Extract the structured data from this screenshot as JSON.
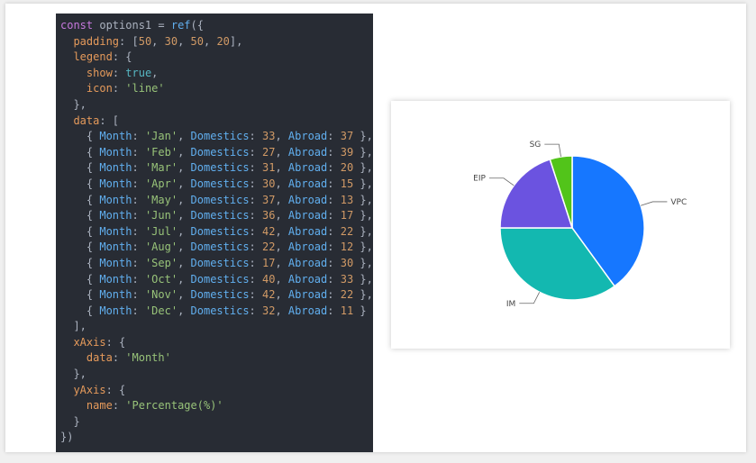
{
  "code": {
    "lines": [
      [
        [
          "const ",
          "kw"
        ],
        [
          "options1 = ",
          "punc"
        ],
        [
          "ref",
          "fn"
        ],
        [
          "({",
          "punc"
        ]
      ],
      [
        [
          "  ",
          "punc"
        ],
        [
          "padding",
          "prop"
        ],
        [
          ": [",
          "punc"
        ],
        [
          "50",
          "num"
        ],
        [
          ", ",
          "punc"
        ],
        [
          "30",
          "num"
        ],
        [
          ", ",
          "punc"
        ],
        [
          "50",
          "num"
        ],
        [
          ", ",
          "punc"
        ],
        [
          "20",
          "num"
        ],
        [
          "],",
          "punc"
        ]
      ],
      [
        [
          "  ",
          "punc"
        ],
        [
          "legend",
          "prop"
        ],
        [
          ": {",
          "punc"
        ]
      ],
      [
        [
          "    ",
          "punc"
        ],
        [
          "show",
          "prop"
        ],
        [
          ": ",
          "punc"
        ],
        [
          "true",
          "bool"
        ],
        [
          ",",
          "punc"
        ]
      ],
      [
        [
          "    ",
          "punc"
        ],
        [
          "icon",
          "prop"
        ],
        [
          ": ",
          "punc"
        ],
        [
          "'line'",
          "str"
        ]
      ],
      [
        [
          "  },",
          "punc"
        ]
      ],
      [
        [
          "  ",
          "punc"
        ],
        [
          "data",
          "prop"
        ],
        [
          ": [",
          "punc"
        ]
      ],
      [
        [
          "    { ",
          "punc"
        ],
        [
          "Month",
          "prop2"
        ],
        [
          ": ",
          "punc"
        ],
        [
          "'Jan'",
          "str"
        ],
        [
          ", ",
          "punc"
        ],
        [
          "Domestics",
          "prop2"
        ],
        [
          ": ",
          "punc"
        ],
        [
          "33",
          "num"
        ],
        [
          ", ",
          "punc"
        ],
        [
          "Abroad",
          "prop2"
        ],
        [
          ": ",
          "punc"
        ],
        [
          "37",
          "num"
        ],
        [
          " },",
          "punc"
        ]
      ],
      [
        [
          "    { ",
          "punc"
        ],
        [
          "Month",
          "prop2"
        ],
        [
          ": ",
          "punc"
        ],
        [
          "'Feb'",
          "str"
        ],
        [
          ", ",
          "punc"
        ],
        [
          "Domestics",
          "prop2"
        ],
        [
          ": ",
          "punc"
        ],
        [
          "27",
          "num"
        ],
        [
          ", ",
          "punc"
        ],
        [
          "Abroad",
          "prop2"
        ],
        [
          ": ",
          "punc"
        ],
        [
          "39",
          "num"
        ],
        [
          " },",
          "punc"
        ]
      ],
      [
        [
          "    { ",
          "punc"
        ],
        [
          "Month",
          "prop2"
        ],
        [
          ": ",
          "punc"
        ],
        [
          "'Mar'",
          "str"
        ],
        [
          ", ",
          "punc"
        ],
        [
          "Domestics",
          "prop2"
        ],
        [
          ": ",
          "punc"
        ],
        [
          "31",
          "num"
        ],
        [
          ", ",
          "punc"
        ],
        [
          "Abroad",
          "prop2"
        ],
        [
          ": ",
          "punc"
        ],
        [
          "20",
          "num"
        ],
        [
          " },",
          "punc"
        ]
      ],
      [
        [
          "    { ",
          "punc"
        ],
        [
          "Month",
          "prop2"
        ],
        [
          ": ",
          "punc"
        ],
        [
          "'Apr'",
          "str"
        ],
        [
          ", ",
          "punc"
        ],
        [
          "Domestics",
          "prop2"
        ],
        [
          ": ",
          "punc"
        ],
        [
          "30",
          "num"
        ],
        [
          ", ",
          "punc"
        ],
        [
          "Abroad",
          "prop2"
        ],
        [
          ": ",
          "punc"
        ],
        [
          "15",
          "num"
        ],
        [
          " },",
          "punc"
        ]
      ],
      [
        [
          "    { ",
          "punc"
        ],
        [
          "Month",
          "prop2"
        ],
        [
          ": ",
          "punc"
        ],
        [
          "'May'",
          "str"
        ],
        [
          ", ",
          "punc"
        ],
        [
          "Domestics",
          "prop2"
        ],
        [
          ": ",
          "punc"
        ],
        [
          "37",
          "num"
        ],
        [
          ", ",
          "punc"
        ],
        [
          "Abroad",
          "prop2"
        ],
        [
          ": ",
          "punc"
        ],
        [
          "13",
          "num"
        ],
        [
          " },",
          "punc"
        ]
      ],
      [
        [
          "    { ",
          "punc"
        ],
        [
          "Month",
          "prop2"
        ],
        [
          ": ",
          "punc"
        ],
        [
          "'Jun'",
          "str"
        ],
        [
          ", ",
          "punc"
        ],
        [
          "Domestics",
          "prop2"
        ],
        [
          ": ",
          "punc"
        ],
        [
          "36",
          "num"
        ],
        [
          ", ",
          "punc"
        ],
        [
          "Abroad",
          "prop2"
        ],
        [
          ": ",
          "punc"
        ],
        [
          "17",
          "num"
        ],
        [
          " },",
          "punc"
        ]
      ],
      [
        [
          "    { ",
          "punc"
        ],
        [
          "Month",
          "prop2"
        ],
        [
          ": ",
          "punc"
        ],
        [
          "'Jul'",
          "str"
        ],
        [
          ", ",
          "punc"
        ],
        [
          "Domestics",
          "prop2"
        ],
        [
          ": ",
          "punc"
        ],
        [
          "42",
          "num"
        ],
        [
          ", ",
          "punc"
        ],
        [
          "Abroad",
          "prop2"
        ],
        [
          ": ",
          "punc"
        ],
        [
          "22",
          "num"
        ],
        [
          " },",
          "punc"
        ]
      ],
      [
        [
          "    { ",
          "punc"
        ],
        [
          "Month",
          "prop2"
        ],
        [
          ": ",
          "punc"
        ],
        [
          "'Aug'",
          "str"
        ],
        [
          ", ",
          "punc"
        ],
        [
          "Domestics",
          "prop2"
        ],
        [
          ": ",
          "punc"
        ],
        [
          "22",
          "num"
        ],
        [
          ", ",
          "punc"
        ],
        [
          "Abroad",
          "prop2"
        ],
        [
          ": ",
          "punc"
        ],
        [
          "12",
          "num"
        ],
        [
          " },",
          "punc"
        ]
      ],
      [
        [
          "    { ",
          "punc"
        ],
        [
          "Month",
          "prop2"
        ],
        [
          ": ",
          "punc"
        ],
        [
          "'Sep'",
          "str"
        ],
        [
          ", ",
          "punc"
        ],
        [
          "Domestics",
          "prop2"
        ],
        [
          ": ",
          "punc"
        ],
        [
          "17",
          "num"
        ],
        [
          ", ",
          "punc"
        ],
        [
          "Abroad",
          "prop2"
        ],
        [
          ": ",
          "punc"
        ],
        [
          "30",
          "num"
        ],
        [
          " },",
          "punc"
        ]
      ],
      [
        [
          "    { ",
          "punc"
        ],
        [
          "Month",
          "prop2"
        ],
        [
          ": ",
          "punc"
        ],
        [
          "'Oct'",
          "str"
        ],
        [
          ", ",
          "punc"
        ],
        [
          "Domestics",
          "prop2"
        ],
        [
          ": ",
          "punc"
        ],
        [
          "40",
          "num"
        ],
        [
          ", ",
          "punc"
        ],
        [
          "Abroad",
          "prop2"
        ],
        [
          ": ",
          "punc"
        ],
        [
          "33",
          "num"
        ],
        [
          " },",
          "punc"
        ]
      ],
      [
        [
          "    { ",
          "punc"
        ],
        [
          "Month",
          "prop2"
        ],
        [
          ": ",
          "punc"
        ],
        [
          "'Nov'",
          "str"
        ],
        [
          ", ",
          "punc"
        ],
        [
          "Domestics",
          "prop2"
        ],
        [
          ": ",
          "punc"
        ],
        [
          "42",
          "num"
        ],
        [
          ", ",
          "punc"
        ],
        [
          "Abroad",
          "prop2"
        ],
        [
          ": ",
          "punc"
        ],
        [
          "22",
          "num"
        ],
        [
          " },",
          "punc"
        ]
      ],
      [
        [
          "    { ",
          "punc"
        ],
        [
          "Month",
          "prop2"
        ],
        [
          ": ",
          "punc"
        ],
        [
          "'Dec'",
          "str"
        ],
        [
          ", ",
          "punc"
        ],
        [
          "Domestics",
          "prop2"
        ],
        [
          ": ",
          "punc"
        ],
        [
          "32",
          "num"
        ],
        [
          ", ",
          "punc"
        ],
        [
          "Abroad",
          "prop2"
        ],
        [
          ": ",
          "punc"
        ],
        [
          "11",
          "num"
        ],
        [
          " }",
          "punc"
        ]
      ],
      [
        [
          "  ],",
          "punc"
        ]
      ],
      [
        [
          "  ",
          "punc"
        ],
        [
          "xAxis",
          "prop"
        ],
        [
          ": {",
          "punc"
        ]
      ],
      [
        [
          "    ",
          "punc"
        ],
        [
          "data",
          "prop"
        ],
        [
          ": ",
          "punc"
        ],
        [
          "'Month'",
          "str"
        ]
      ],
      [
        [
          "  },",
          "punc"
        ]
      ],
      [
        [
          "  ",
          "punc"
        ],
        [
          "yAxis",
          "prop"
        ],
        [
          ": {",
          "punc"
        ]
      ],
      [
        [
          "    ",
          "punc"
        ],
        [
          "name",
          "prop"
        ],
        [
          ": ",
          "punc"
        ],
        [
          "'Percentage(%)'",
          "str"
        ]
      ],
      [
        [
          "  }",
          "punc"
        ]
      ],
      [
        [
          "})",
          "punc"
        ]
      ]
    ]
  },
  "chart_data": {
    "type": "pie",
    "title": "",
    "slices": [
      {
        "label": "VPC",
        "value": 40,
        "color": "#1677ff"
      },
      {
        "label": "IM",
        "value": 35,
        "color": "#13b8b0"
      },
      {
        "label": "EIP",
        "value": 20,
        "color": "#6b53e0"
      },
      {
        "label": "SG",
        "value": 5,
        "color": "#52c41a"
      }
    ],
    "legend": "none"
  }
}
